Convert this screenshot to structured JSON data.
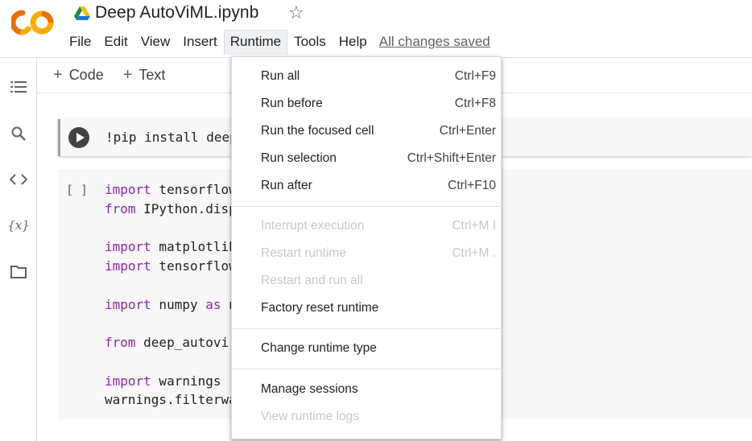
{
  "header": {
    "title": "Deep AutoViML.ipynb",
    "logo_text": "CO",
    "menu": [
      "File",
      "Edit",
      "View",
      "Insert",
      "Runtime",
      "Tools",
      "Help"
    ],
    "saved_status": "All changes saved"
  },
  "toolbar": {
    "code_label": "Code",
    "text_label": "Text"
  },
  "sidebar": {
    "icons": [
      "table-of-contents-icon",
      "search-icon",
      "code-snippets-icon",
      "variables-icon",
      "files-icon"
    ],
    "variables_glyph": "{x}"
  },
  "cells": {
    "cell1_code": "!pip install deep",
    "cell2_exec": "[ ]",
    "cell2_lines": [
      {
        "kw": "import",
        "rest": " tensorflow"
      },
      {
        "kw": "from",
        "rest": " IPython.disp"
      },
      {
        "kw": "",
        "rest": ""
      },
      {
        "kw": "import",
        "rest": " matplotlib"
      },
      {
        "kw": "import",
        "rest": " tensorflow"
      },
      {
        "kw": "",
        "rest": ""
      },
      {
        "kw": "import",
        "rest": " numpy ",
        "kw2": "as",
        "rest2": " n"
      },
      {
        "kw": "",
        "rest": ""
      },
      {
        "kw": "from",
        "rest": " deep_autovi"
      },
      {
        "kw": "",
        "rest": ""
      },
      {
        "kw": "import",
        "rest": " warnings"
      },
      {
        "kw": "",
        "rest": "warnings.filterwa"
      }
    ]
  },
  "runtime_menu": {
    "items": [
      {
        "label": "Run all",
        "shortcut": "Ctrl+F9",
        "disabled": false
      },
      {
        "label": "Run before",
        "shortcut": "Ctrl+F8",
        "disabled": false
      },
      {
        "label": "Run the focused cell",
        "shortcut": "Ctrl+Enter",
        "disabled": false
      },
      {
        "label": "Run selection",
        "shortcut": "Ctrl+Shift+Enter",
        "disabled": false
      },
      {
        "label": "Run after",
        "shortcut": "Ctrl+F10",
        "disabled": false
      },
      {
        "label": "Interrupt execution",
        "shortcut": "Ctrl+M I",
        "disabled": true
      },
      {
        "label": "Restart runtime",
        "shortcut": "Ctrl+M .",
        "disabled": true
      },
      {
        "label": "Restart and run all",
        "shortcut": "",
        "disabled": true
      },
      {
        "label": "Factory reset runtime",
        "shortcut": "",
        "disabled": false
      },
      {
        "label": "Change runtime type",
        "shortcut": "",
        "disabled": false
      },
      {
        "label": "Manage sessions",
        "shortcut": "",
        "disabled": false
      },
      {
        "label": "View runtime logs",
        "shortcut": "",
        "disabled": true
      }
    ]
  },
  "colors": {
    "logo_orange": "#F9AB00",
    "logo_dark_orange": "#E8710A",
    "keyword_purple": "#8E24AA",
    "disabled_text": "#C8C8C8"
  }
}
